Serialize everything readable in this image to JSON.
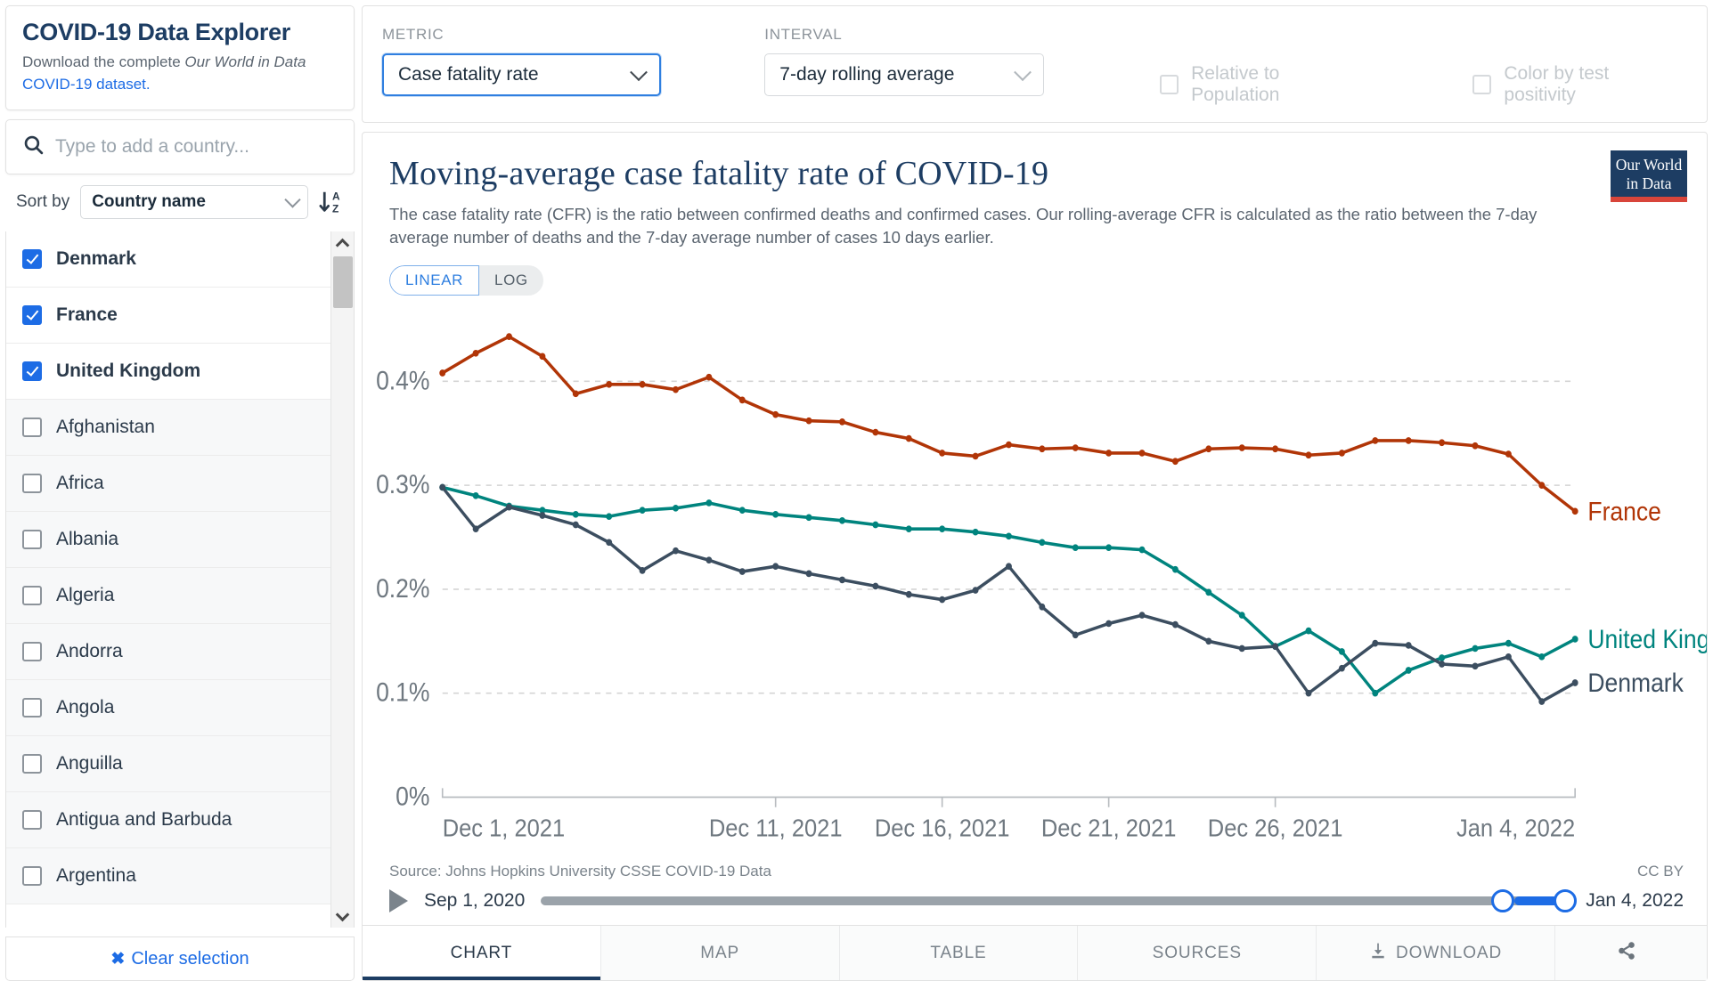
{
  "explorer": {
    "title": "COVID-19 Data Explorer",
    "subtitle_pre": "Download the complete ",
    "subtitle_em": "Our World in Data",
    "subtitle_link": " COVID-19 dataset.",
    "search_placeholder": "Type to add a country...",
    "search_value": "",
    "search_icon": "search-icon",
    "sort_label": "Sort by",
    "sort_value": "Country name",
    "sort_direction_icon": "sort-ascending-alpha-icon",
    "clear_selection": "Clear selection",
    "clear_icon": "close-x-icon",
    "countries": [
      {
        "name": "Denmark",
        "checked": true
      },
      {
        "name": "France",
        "checked": true
      },
      {
        "name": "United Kingdom",
        "checked": true
      },
      {
        "name": "Afghanistan",
        "checked": false
      },
      {
        "name": "Africa",
        "checked": false
      },
      {
        "name": "Albania",
        "checked": false
      },
      {
        "name": "Algeria",
        "checked": false
      },
      {
        "name": "Andorra",
        "checked": false
      },
      {
        "name": "Angola",
        "checked": false
      },
      {
        "name": "Anguilla",
        "checked": false
      },
      {
        "name": "Antigua and Barbuda",
        "checked": false
      },
      {
        "name": "Argentina",
        "checked": false
      }
    ]
  },
  "controls": {
    "metric_label": "METRIC",
    "metric_value": "Case fatality rate",
    "interval_label": "INTERVAL",
    "interval_value": "7-day rolling average",
    "relative_to_population": "Relative to Population",
    "relative_to_population_checked": false,
    "color_by_test_positivity": "Color by test positivity",
    "color_by_test_positivity_checked": false
  },
  "chart": {
    "title": "Moving-average case fatality rate of COVID-19",
    "subtitle": "The case fatality rate (CFR) is the ratio between confirmed deaths and confirmed cases. Our rolling-average CFR is calculated as the ratio between the 7-day average number of deaths and the 7-day average number of cases 10 days earlier.",
    "logo_line1": "Our World",
    "logo_line2": "in Data",
    "scale_linear": "LINEAR",
    "scale_log": "LOG",
    "scale_active": "LINEAR",
    "source": "Source: Johns Hopkins University CSSE COVID-19 Data",
    "license": "CC BY"
  },
  "timeline": {
    "play_icon": "play-icon",
    "start_date": "Sep 1, 2020",
    "end_date": "Jan 4, 2022"
  },
  "tabs": [
    {
      "label": "CHART",
      "active": true,
      "icon": null
    },
    {
      "label": "MAP",
      "active": false,
      "icon": null
    },
    {
      "label": "TABLE",
      "active": false,
      "icon": null
    },
    {
      "label": "SOURCES",
      "active": false,
      "icon": null
    },
    {
      "label": "DOWNLOAD",
      "active": false,
      "icon": "download-icon"
    },
    {
      "label": "",
      "active": false,
      "icon": "share-icon"
    }
  ],
  "colors": {
    "france": "#b13507",
    "united_kingdom": "#00847e",
    "denmark": "#3c4e60",
    "accent_blue": "#1d6ce5",
    "brand_navy": "#1d3d63",
    "brand_red": "#d8453a"
  },
  "chart_data": {
    "type": "line",
    "title": "Moving-average case fatality rate of COVID-19",
    "subtitle": "The case fatality rate (CFR) is the ratio between confirmed deaths and confirmed cases. Our rolling-average CFR is calculated as the ratio between the 7-day average number of deaths and the 7-day average number of cases 10 days earlier.",
    "xlabel": "",
    "ylabel": "",
    "ylim": [
      0,
      0.46
    ],
    "yticks": [
      0,
      0.1,
      0.2,
      0.3,
      0.4
    ],
    "ytick_labels": [
      "0%",
      "0.1%",
      "0.2%",
      "0.3%",
      "0.4%"
    ],
    "grid": true,
    "legend": "right-inline-labels",
    "x": [
      "Dec 1, 2021",
      "Dec 2, 2021",
      "Dec 3, 2021",
      "Dec 4, 2021",
      "Dec 5, 2021",
      "Dec 6, 2021",
      "Dec 7, 2021",
      "Dec 8, 2021",
      "Dec 9, 2021",
      "Dec 10, 2021",
      "Dec 11, 2021",
      "Dec 12, 2021",
      "Dec 13, 2021",
      "Dec 14, 2021",
      "Dec 15, 2021",
      "Dec 16, 2021",
      "Dec 17, 2021",
      "Dec 18, 2021",
      "Dec 19, 2021",
      "Dec 20, 2021",
      "Dec 21, 2021",
      "Dec 22, 2021",
      "Dec 23, 2021",
      "Dec 24, 2021",
      "Dec 25, 2021",
      "Dec 26, 2021",
      "Dec 27, 2021",
      "Dec 28, 2021",
      "Dec 29, 2021",
      "Dec 30, 2021",
      "Dec 31, 2021",
      "Jan 1, 2022",
      "Jan 2, 2022",
      "Jan 3, 2022",
      "Jan 4, 2022"
    ],
    "xtick_labels": [
      "Dec 1, 2021",
      "Dec 11, 2021",
      "Dec 16, 2021",
      "Dec 21, 2021",
      "Dec 26, 2021",
      "Jan 4, 2022"
    ],
    "xtick_index": [
      0,
      10,
      15,
      20,
      25,
      34
    ],
    "series": [
      {
        "name": "France",
        "color": "#b13507",
        "values": [
          0.408,
          0.427,
          0.443,
          0.424,
          0.388,
          0.397,
          0.397,
          0.392,
          0.404,
          0.382,
          0.368,
          0.362,
          0.361,
          0.351,
          0.345,
          0.331,
          0.328,
          0.339,
          0.335,
          0.336,
          0.331,
          0.331,
          0.323,
          0.335,
          0.336,
          0.335,
          0.329,
          0.331,
          0.343,
          0.343,
          0.341,
          0.338,
          0.33,
          0.3,
          0.275
        ]
      },
      {
        "name": "United Kingdom",
        "color": "#00847e",
        "values": [
          0.298,
          0.29,
          0.28,
          0.276,
          0.272,
          0.27,
          0.276,
          0.278,
          0.283,
          0.276,
          0.272,
          0.269,
          0.266,
          0.262,
          0.258,
          0.258,
          0.255,
          0.251,
          0.245,
          0.24,
          0.24,
          0.238,
          0.219,
          0.197,
          0.175,
          0.145,
          0.16,
          0.14,
          0.1,
          0.122,
          0.134,
          0.143,
          0.148,
          0.135,
          0.152
        ]
      },
      {
        "name": "Denmark",
        "color": "#3c4e60",
        "values": [
          0.298,
          0.258,
          0.279,
          0.271,
          0.262,
          0.245,
          0.218,
          0.237,
          0.228,
          0.217,
          0.222,
          0.215,
          0.209,
          0.203,
          0.195,
          0.19,
          0.199,
          0.222,
          0.183,
          0.156,
          0.167,
          0.175,
          0.166,
          0.15,
          0.143,
          0.145,
          0.1,
          0.124,
          0.148,
          0.146,
          0.128,
          0.126,
          0.135,
          0.092,
          0.11
        ]
      }
    ]
  }
}
